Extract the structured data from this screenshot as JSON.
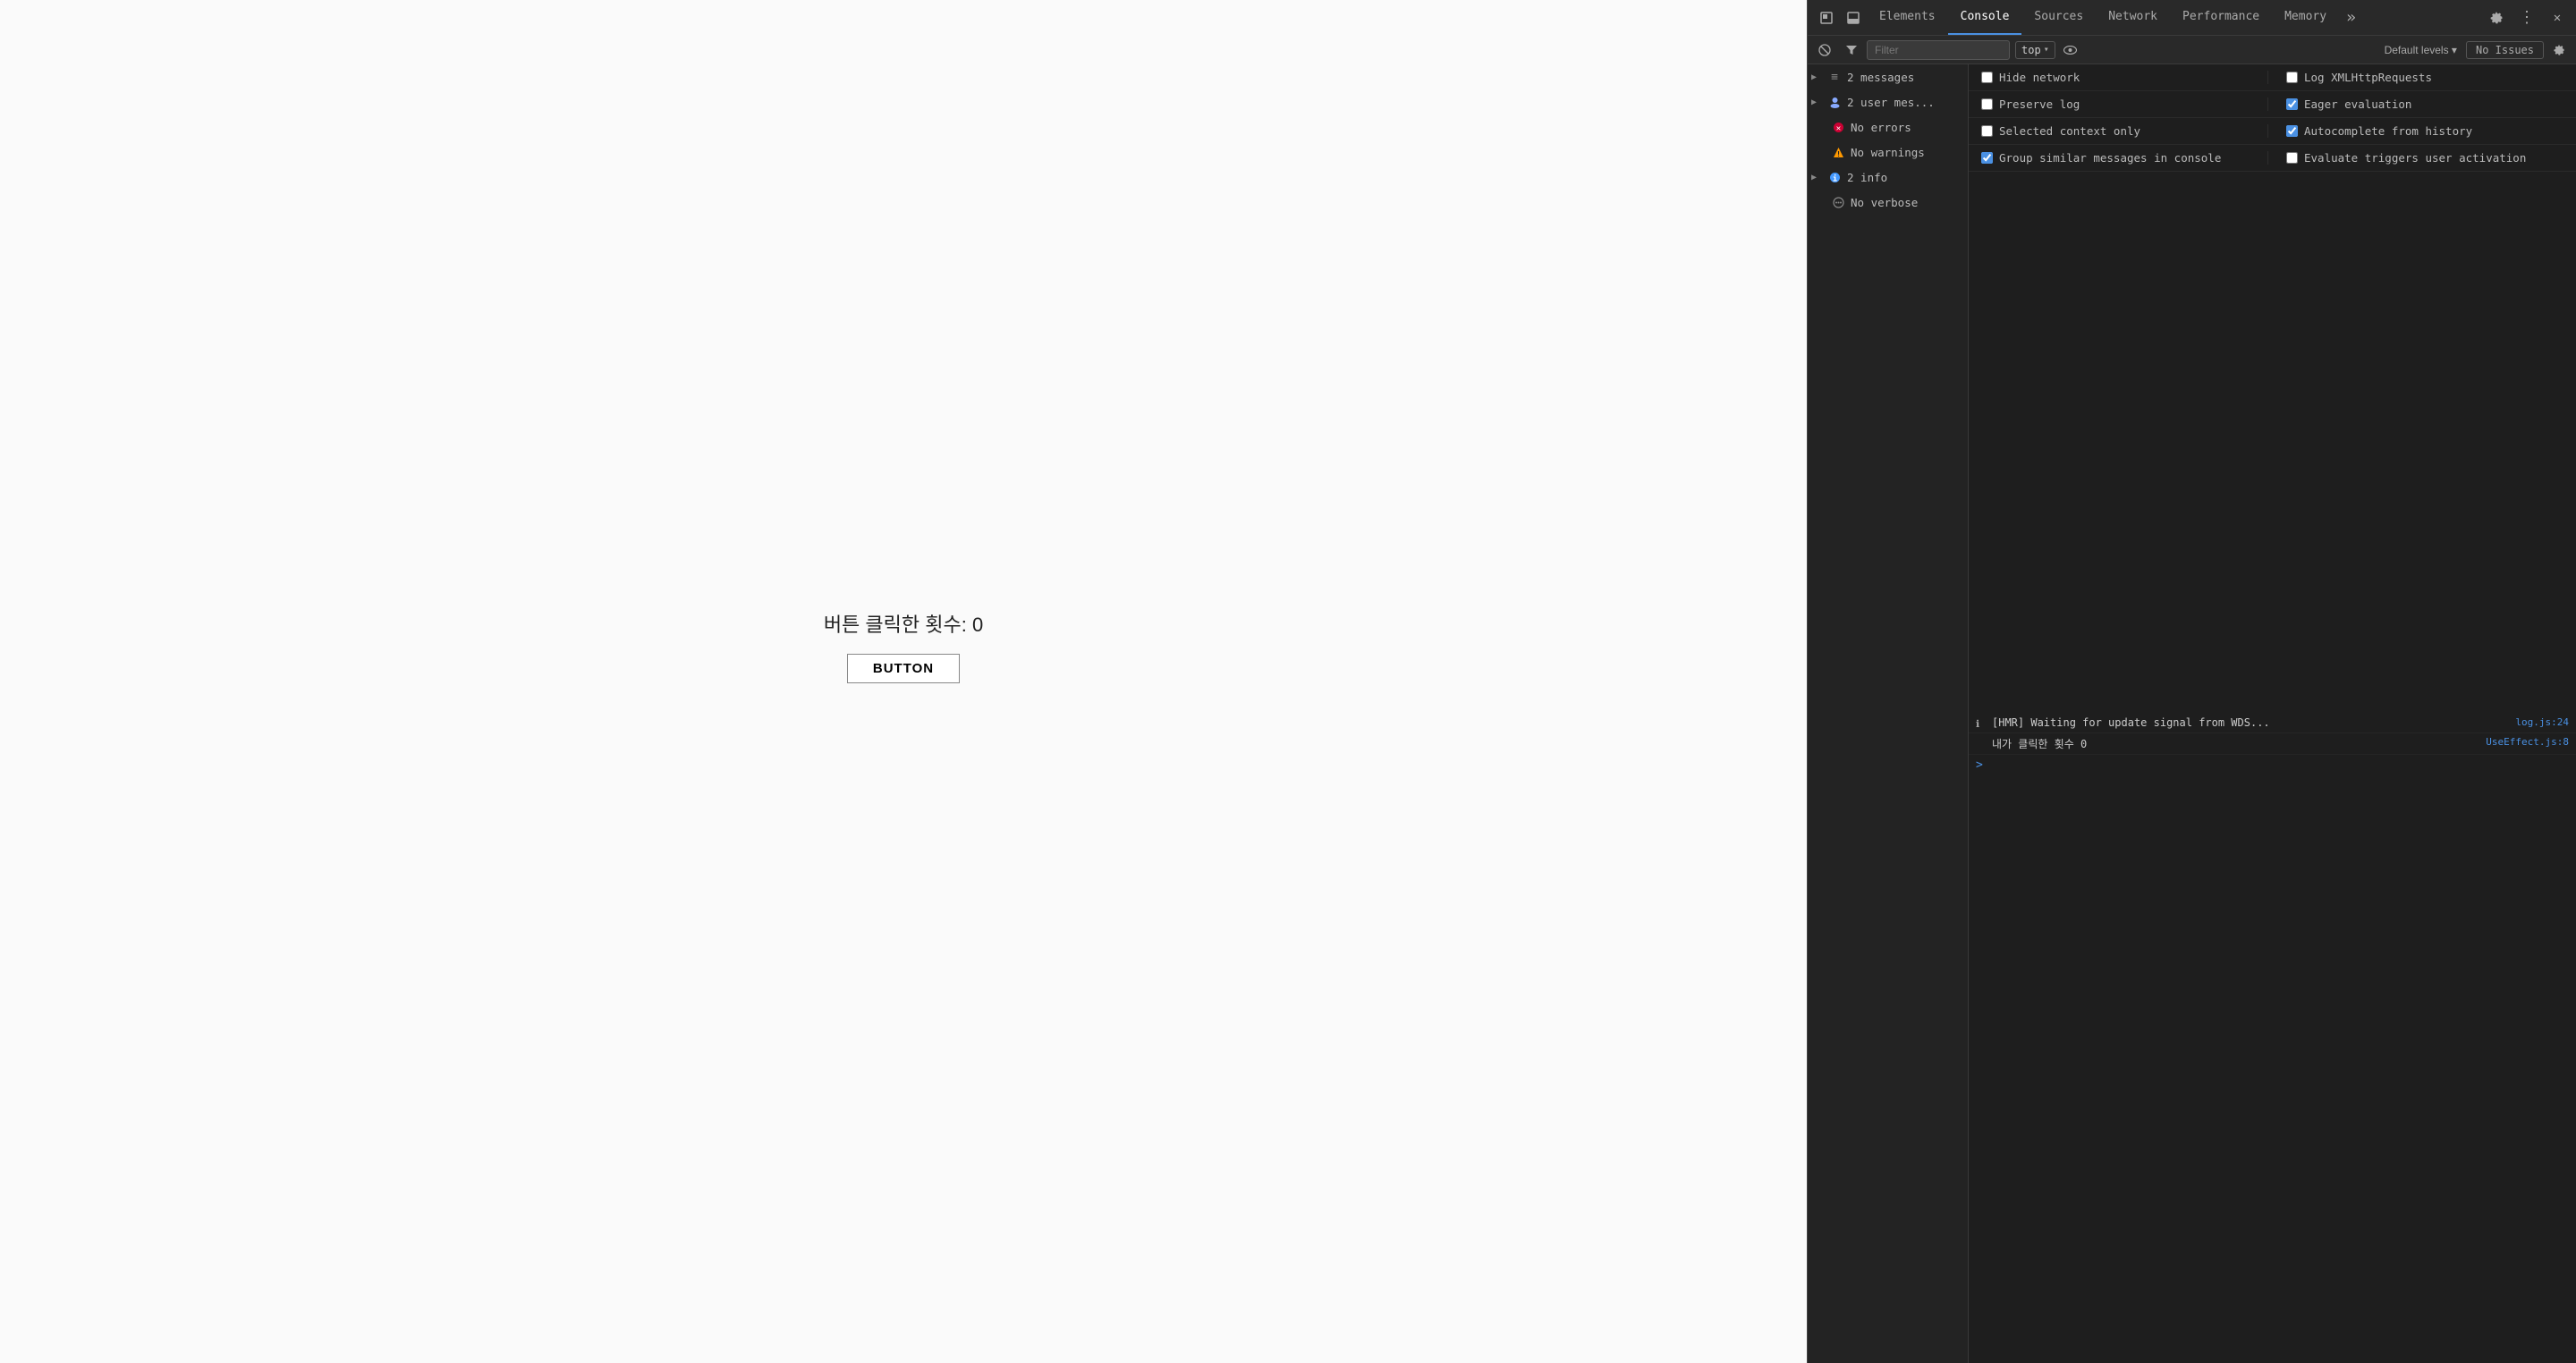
{
  "mainPage": {
    "clickCountLabel": "버튼 클릭한 횟수: 0",
    "buttonLabel": "BUTTON"
  },
  "devtools": {
    "topbar": {
      "undockIcon": "⊡",
      "dockIcon": "⬒",
      "tabs": [
        {
          "id": "elements",
          "label": "Elements",
          "active": false
        },
        {
          "id": "console",
          "label": "Console",
          "active": true
        },
        {
          "id": "sources",
          "label": "Sources",
          "active": false
        },
        {
          "id": "network",
          "label": "Network",
          "active": false
        },
        {
          "id": "performance",
          "label": "Performance",
          "active": false
        },
        {
          "id": "memory",
          "label": "Memory",
          "active": false
        }
      ],
      "moreTabsLabel": "»",
      "settingsIcon": "⚙",
      "moreIcon": "⋮",
      "closeIcon": "✕"
    },
    "toolbar": {
      "clearIcon": "🚫",
      "filterPlaceholder": "Filter",
      "topLabel": "top",
      "dropdownIcon": "▾",
      "eyeIcon": "👁",
      "defaultLevelsLabel": "Default levels ▾",
      "noIssuesLabel": "No Issues",
      "settingsIcon": "⚙"
    },
    "sidebar": {
      "items": [
        {
          "id": "messages",
          "icon": "≡",
          "iconClass": "icon-messages",
          "label": "2 messages",
          "hasArrow": true
        },
        {
          "id": "user-messages",
          "icon": "👤",
          "iconClass": "icon-user",
          "label": "2 user mes...",
          "hasArrow": true
        },
        {
          "id": "errors",
          "icon": "✖",
          "iconClass": "icon-error",
          "label": "No errors",
          "hasArrow": false
        },
        {
          "id": "warnings",
          "icon": "⚠",
          "iconClass": "icon-warning",
          "label": "No warnings",
          "hasArrow": false
        },
        {
          "id": "info",
          "icon": "ℹ",
          "iconClass": "icon-info",
          "label": "2 info",
          "hasArrow": true
        },
        {
          "id": "verbose",
          "icon": "☁",
          "iconClass": "icon-verbose",
          "label": "No verbose",
          "hasArrow": false
        }
      ]
    },
    "settings": {
      "rows": [
        {
          "left": {
            "checked": false,
            "label": "Hide network"
          },
          "right": {
            "checked": false,
            "label": "Log XMLHttpRequests"
          }
        },
        {
          "left": {
            "checked": false,
            "label": "Preserve log"
          },
          "right": {
            "checked": true,
            "label": "Eager evaluation"
          }
        },
        {
          "left": {
            "checked": false,
            "label": "Selected context only"
          },
          "right": {
            "checked": true,
            "label": "Autocomplete from history"
          }
        },
        {
          "left": {
            "checked": true,
            "label": "Group similar messages in console"
          },
          "right": {
            "checked": false,
            "label": "Evaluate triggers user activation"
          }
        }
      ]
    },
    "console": {
      "entries": [
        {
          "text": "[HMR] Waiting for update signal from WDS...",
          "source": "log.js:24"
        },
        {
          "text": "내가 클릭한 횟수 0",
          "source": "UseEffect.js:8"
        }
      ],
      "promptArrow": ">"
    }
  }
}
